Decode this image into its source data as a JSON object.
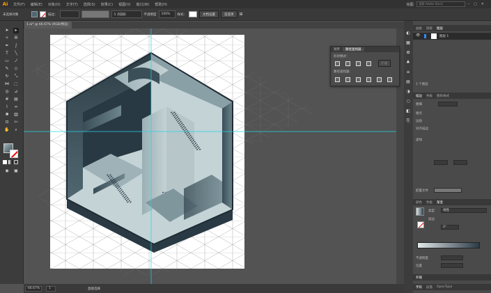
{
  "app": {
    "logo": "Ai",
    "menus": [
      "文件(F)",
      "编辑(E)",
      "对象(O)",
      "文字(T)",
      "选择(S)",
      "效果(C)",
      "视图(V)",
      "窗口(W)",
      "帮助(H)"
    ],
    "workspace": "绘图",
    "search_placeholder": "搜索 Adobe Stock"
  },
  "control": {
    "selection": "未选择对象",
    "stroke_label": "描边：",
    "brush": "5 点圆形",
    "opacity_label": "不透明度",
    "opacity": "100%",
    "style_label": "样式：",
    "doc_setup": "文档设置",
    "prefs": "首选项"
  },
  "document": {
    "tab": "1.ai* @ 66.67% (RGB/预览)"
  },
  "status": {
    "zoom": "66.67%",
    "page": "1",
    "tool": "直接选择"
  },
  "pathfinder": {
    "tabs": [
      "对齐",
      "路径查找器"
    ],
    "shape_modes": "形状模式：",
    "pathfinders": "路径查找器：",
    "expand": "扩展"
  },
  "layers": {
    "tabs": [
      "画板",
      "链接",
      "图层"
    ],
    "layer": "图层 1",
    "count": "1 个图层"
  },
  "transform": {
    "tabs": [
      "描边",
      "色板",
      "图形样式"
    ],
    "weight": "粗细",
    "cap": "端点",
    "corner": "边角",
    "align": "对齐描边",
    "dashed": "虚线",
    "profile": "配置文件"
  },
  "gradient": {
    "tabs": [
      "颜色",
      "色板",
      "渐变"
    ],
    "type_label": "类型",
    "type": "线性",
    "stroke_label": "描边",
    "angle": "0°",
    "opacity_label": "不透明度",
    "location_label": "位置"
  },
  "bottom": {
    "tabs": [
      "字符",
      "段落",
      "OpenType"
    ],
    "appearance": "外观"
  }
}
